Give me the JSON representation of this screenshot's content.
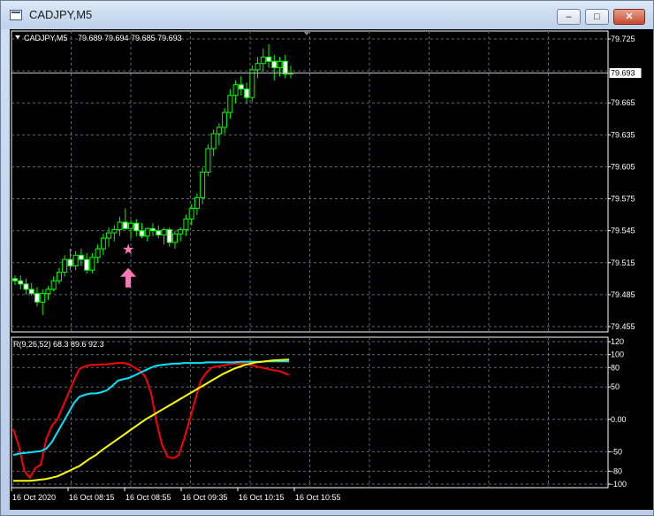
{
  "window": {
    "title": "CADJPY,M5",
    "minimize_glyph": "–",
    "maximize_glyph": "□",
    "close_glyph": "✕"
  },
  "colors": {
    "background": "#000000",
    "grid": "#5a6a78",
    "axis_text": "#ffffff",
    "bull_candle": "#00ff00",
    "bull_body": "#000000",
    "bear_candle": "#00ff00",
    "bear_body": "#ffffff",
    "red_line": "#ff0000",
    "cyan_line": "#00e5ff",
    "yellow_line": "#ffff00",
    "marker": "#ff77b7"
  },
  "chart_data": [
    {
      "type": "candlestick",
      "symbol_label": "CADJPY,M5",
      "ohlc_label": "79.689 79.694 79.685 79.693",
      "current_price_label": "79.693",
      "y_ticks": [
        "79.725",
        "79.695",
        "79.665",
        "79.635",
        "79.605",
        "79.575",
        "79.545",
        "79.515",
        "79.485",
        "79.455"
      ],
      "ylim": [
        79.455,
        79.725
      ],
      "x_ticks": [
        "16 Oct 2020",
        "16 Oct 08:15",
        "16 Oct 08:55",
        "16 Oct 09:35",
        "16 Oct 10:15",
        "16 Oct 10:55"
      ],
      "candles": [
        [
          79.5,
          79.503,
          79.494,
          79.498
        ],
        [
          79.498,
          79.503,
          79.49,
          79.495
        ],
        [
          79.495,
          79.5,
          79.485,
          79.49
        ],
        [
          79.49,
          79.496,
          79.484,
          79.486
        ],
        [
          79.486,
          79.492,
          79.474,
          79.478
        ],
        [
          79.478,
          79.49,
          79.466,
          79.486
        ],
        [
          79.486,
          79.493,
          79.48,
          79.49
        ],
        [
          79.49,
          79.502,
          79.488,
          79.498
        ],
        [
          79.498,
          79.51,
          79.495,
          79.506
        ],
        [
          79.506,
          79.522,
          79.502,
          79.518
        ],
        [
          79.518,
          79.528,
          79.508,
          79.512
        ],
        [
          79.512,
          79.526,
          79.508,
          79.522
        ],
        [
          79.522,
          79.528,
          79.512,
          79.518
        ],
        [
          79.518,
          79.524,
          79.505,
          79.508
        ],
        [
          79.508,
          79.524,
          79.505,
          79.52
        ],
        [
          79.52,
          79.532,
          79.515,
          79.528
        ],
        [
          79.528,
          79.542,
          79.522,
          79.538
        ],
        [
          79.538,
          79.548,
          79.53,
          79.543
        ],
        [
          79.543,
          79.55,
          79.535,
          79.546
        ],
        [
          79.546,
          79.558,
          79.54,
          79.553
        ],
        [
          79.553,
          79.566,
          79.546,
          79.547
        ],
        [
          79.547,
          79.555,
          79.538,
          79.552
        ],
        [
          79.552,
          79.556,
          79.54,
          79.545
        ],
        [
          79.545,
          79.552,
          79.538,
          79.54
        ],
        [
          79.54,
          79.548,
          79.535,
          79.547
        ],
        [
          79.547,
          79.552,
          79.54,
          79.545
        ],
        [
          79.545,
          79.55,
          79.538,
          79.541
        ],
        [
          79.541,
          79.548,
          79.532,
          79.546
        ],
        [
          79.546,
          79.548,
          79.53,
          79.534
        ],
        [
          79.534,
          79.545,
          79.528,
          79.542
        ],
        [
          79.542,
          79.548,
          79.535,
          79.546
        ],
        [
          79.546,
          79.56,
          79.54,
          79.556
        ],
        [
          79.556,
          79.57,
          79.55,
          79.566
        ],
        [
          79.566,
          79.58,
          79.56,
          79.576
        ],
        [
          79.576,
          79.604,
          79.57,
          79.6
        ],
        [
          79.6,
          79.626,
          79.596,
          79.622
        ],
        [
          79.622,
          79.64,
          79.615,
          79.636
        ],
        [
          79.636,
          79.646,
          79.625,
          79.642
        ],
        [
          79.642,
          79.66,
          79.636,
          79.656
        ],
        [
          79.656,
          79.678,
          79.65,
          79.672
        ],
        [
          79.672,
          79.686,
          79.665,
          79.682
        ],
        [
          79.682,
          79.69,
          79.672,
          79.678
        ],
        [
          79.678,
          79.684,
          79.664,
          79.67
        ],
        [
          79.67,
          79.7,
          79.666,
          79.696
        ],
        [
          79.696,
          79.708,
          79.688,
          79.702
        ],
        [
          79.702,
          79.716,
          79.694,
          79.708
        ],
        [
          79.708,
          79.72,
          79.698,
          79.704
        ],
        [
          79.704,
          79.71,
          79.686,
          79.698
        ],
        [
          79.698,
          79.708,
          79.69,
          79.704
        ],
        [
          79.704,
          79.71,
          79.688,
          79.692
        ],
        [
          79.692,
          79.7,
          79.688,
          79.693
        ]
      ],
      "signal_marker": {
        "type": "buy",
        "star_price": 79.528,
        "arrow_price": 79.51,
        "candle_index": 21
      }
    },
    {
      "type": "line",
      "indicator_label": "R(9,26,52) 68.3 89.6 92.3",
      "y_ticks": [
        "120",
        "100",
        "80",
        "50",
        "0.00",
        "-50",
        "-80",
        "-100"
      ],
      "ylim": [
        -100,
        120
      ],
      "series": [
        {
          "color": "red",
          "values": [
            -15,
            -40,
            -80,
            -90,
            -75,
            -70,
            -30,
            -10,
            0,
            20,
            40,
            60,
            78,
            82,
            84,
            84,
            85,
            85,
            86,
            87,
            87,
            85,
            80,
            75,
            65,
            40,
            -5,
            -40,
            -58,
            -60,
            -55,
            -30,
            0,
            30,
            60,
            72,
            80,
            82,
            83,
            85,
            86,
            86,
            86,
            84,
            82,
            80,
            78,
            76,
            75,
            72,
            68.3
          ]
        },
        {
          "color": "cyan",
          "values": [
            -55,
            -53,
            -52,
            -51,
            -50,
            -49,
            -45,
            -35,
            -20,
            -5,
            10,
            25,
            35,
            38,
            40,
            40,
            42,
            45,
            52,
            60,
            62,
            64,
            68,
            72,
            76,
            80,
            83,
            84,
            85,
            86,
            86,
            87,
            87,
            87,
            87,
            88,
            88,
            88,
            88,
            88,
            88,
            89,
            89,
            89,
            89,
            89,
            89.5,
            89.5,
            89.6,
            89.6,
            89.6
          ]
        },
        {
          "color": "yellow",
          "values": [
            -95,
            -95,
            -95,
            -95,
            -94,
            -93,
            -92,
            -90,
            -88,
            -84,
            -80,
            -76,
            -72,
            -66,
            -60,
            -55,
            -48,
            -42,
            -36,
            -30,
            -24,
            -18,
            -12,
            -6,
            0,
            5,
            10,
            15,
            20,
            25,
            30,
            35,
            40,
            45,
            50,
            55,
            60,
            65,
            70,
            74,
            78,
            81,
            84,
            86,
            88,
            89,
            90,
            91,
            91.5,
            92,
            92.3
          ]
        }
      ]
    }
  ]
}
